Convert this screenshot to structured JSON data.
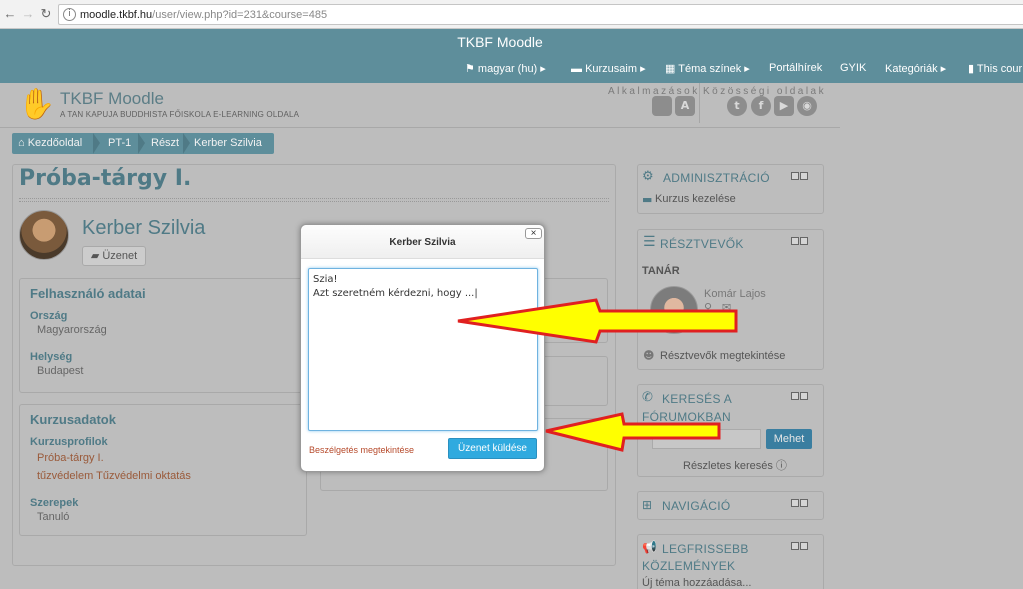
{
  "browser": {
    "url_host": "moodle.tkbf.hu",
    "url_path": "/user/view.php?id=231&course=485"
  },
  "header": {
    "site_title": "TKBF Moodle",
    "menu": [
      {
        "label": "magyar (hu)"
      },
      {
        "label": "Kurzusaim"
      },
      {
        "label": "Téma színek"
      },
      {
        "label": "Portálhírek"
      },
      {
        "label": "GYIK"
      },
      {
        "label": "Kategóriák"
      },
      {
        "label": "This cour"
      }
    ]
  },
  "brand": {
    "name": "TKBF Moodle",
    "subtitle": "A TAN KAPUJA BUDDHISTA FŐISKOLA E-LEARNING OLDALA",
    "apps_label": "Alkalmazások",
    "social_label": "Közösségi oldalak"
  },
  "breadcrumb": [
    "Kezdőoldal",
    "PT-1",
    "Részt",
    "Kerber Szilvia"
  ],
  "main": {
    "course_title": "Próba-tárgy I.",
    "user_name": "Kerber Szilvia",
    "message_button": "Üzenet",
    "user_details": {
      "title": "Felhasználó adatai",
      "country_label": "Ország",
      "country": "Magyarország",
      "city_label": "Helység",
      "city": "Budapest"
    },
    "course_details": {
      "title": "Kurzusadatok",
      "profiles_label": "Kurzusprofilok",
      "profile_1": "Próba-tárgy I.",
      "profile_2": "tűzvédelem Tűzvédelmi oktatás",
      "roles_label": "Szerepek",
      "role": "Tanuló"
    }
  },
  "sidebar": {
    "admin": {
      "title": "ADMINISZTRÁCIÓ",
      "item": "Kurzus kezelése"
    },
    "participants": {
      "title": "RÉSZTVEVŐK",
      "teacher_label": "TANÁR",
      "teacher_name": "Komár Lajos",
      "view_all": "Résztvevők megtekintése"
    },
    "forum_search": {
      "title_1": "KERESÉS A",
      "title_2": "FÓRUMOKBAN",
      "button": "Mehet",
      "advanced": "Részletes keresés"
    },
    "navigation": {
      "title": "NAVIGÁCIÓ"
    },
    "news": {
      "title_1": "LEGFRISSEBB",
      "title_2": "KÖZLEMÉNYEK",
      "add": "Új téma hozzáadása..."
    }
  },
  "modal": {
    "title": "Kerber Szilvia",
    "close": "×",
    "message_text": "Szia!\nAzt szeretném kérdezni, hogy ...|",
    "view_conversation": "Beszélgetés megtekintése",
    "send_button": "Üzenet küldése"
  },
  "colors": {
    "header_bg": "#5e8e9b",
    "accent": "#4f7a86",
    "send_button": "#30aadf",
    "arrow_fill": "#ffff00",
    "arrow_stroke": "#e02020"
  }
}
